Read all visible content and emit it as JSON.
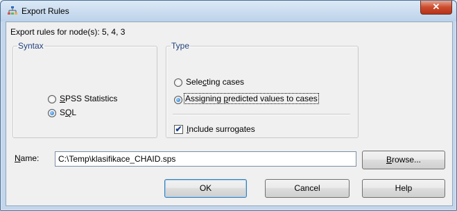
{
  "window": {
    "title": "Export Rules",
    "close_glyph": "✕"
  },
  "header": {
    "text": "Export rules for node(s): 5, 4, 3"
  },
  "syntax": {
    "legend": "Syntax",
    "options": [
      {
        "pre": "",
        "u": "S",
        "post": "PSS Statistics",
        "selected": false
      },
      {
        "pre": "S",
        "u": "Q",
        "post": "L",
        "selected": true
      }
    ]
  },
  "type": {
    "legend": "Type",
    "options": [
      {
        "pre": "Sele",
        "u": "c",
        "post": "ting cases",
        "selected": false
      },
      {
        "pre": "Assigning ",
        "u": "p",
        "post": "redicted values to cases",
        "selected": true
      }
    ],
    "include_surrogates": {
      "pre": "",
      "u": "I",
      "post": "nclude surrogates",
      "checked": true
    }
  },
  "name_field": {
    "label_u": "N",
    "label_post": "ame:",
    "value": "C:\\Temp\\klasifikace_CHAID.sps"
  },
  "buttons": {
    "browse": {
      "u": "B",
      "post": "rowse..."
    },
    "ok": "OK",
    "cancel": "Cancel",
    "help": "Help"
  }
}
